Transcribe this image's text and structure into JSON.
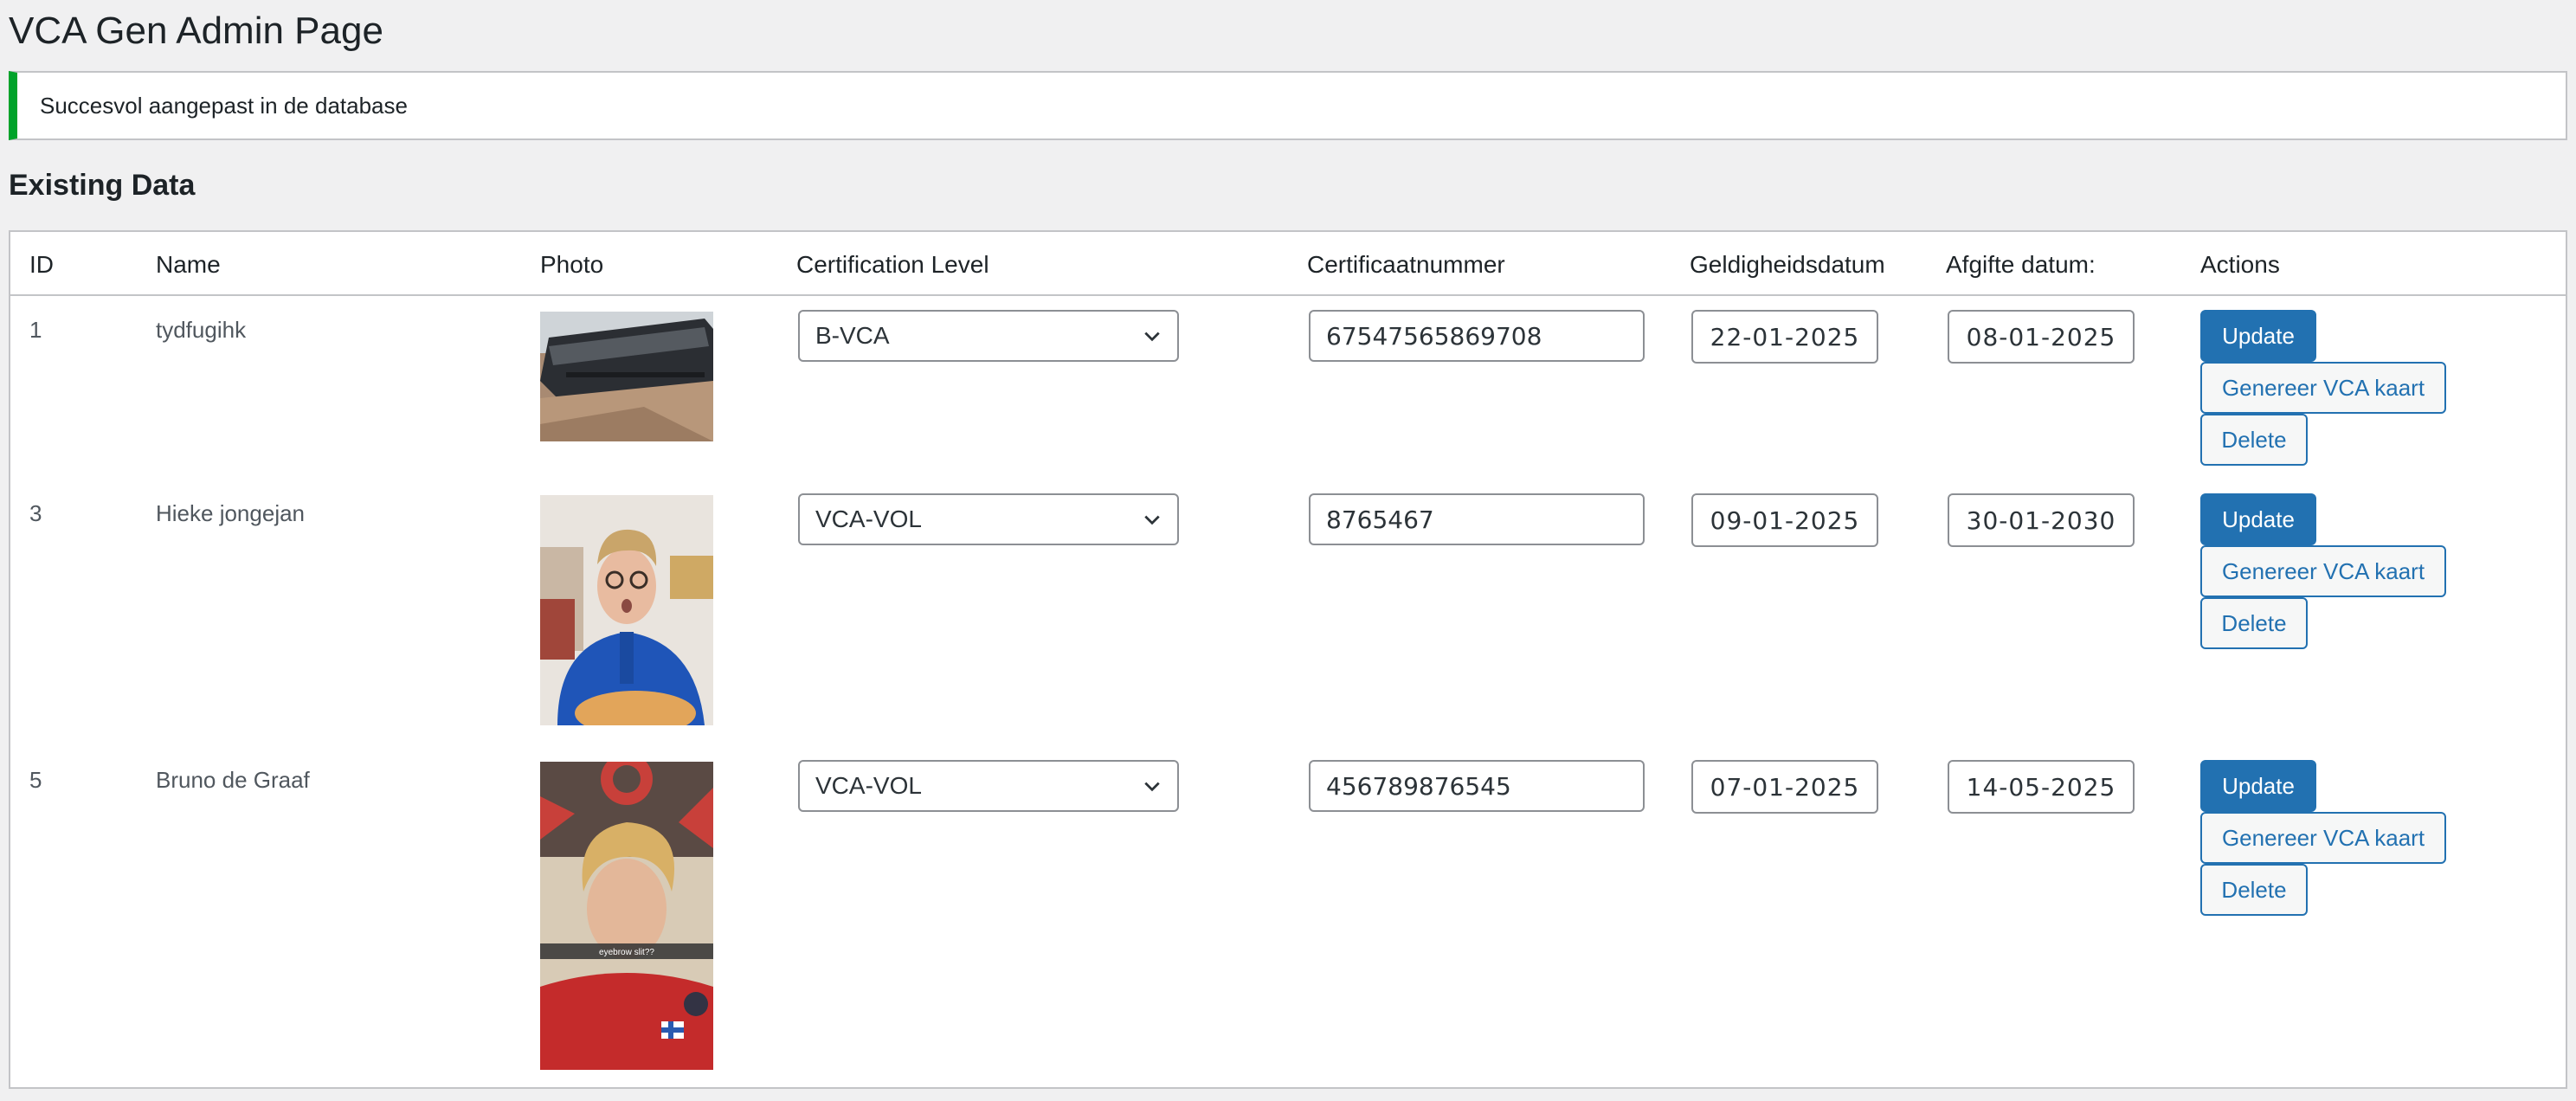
{
  "page": {
    "title": "VCA Gen Admin Page",
    "notice": "Succesvol aangepast in de database",
    "section_title": "Existing Data"
  },
  "table": {
    "headers": {
      "id": "ID",
      "name": "Name",
      "photo": "Photo",
      "level": "Certification Level",
      "number": "Certificaatnummer",
      "valid": "Geldigheidsdatum",
      "issued": "Afgifte datum:",
      "actions": "Actions"
    },
    "rows": [
      {
        "id": "1",
        "name": "tydfugihk",
        "level": "B-VCA",
        "number": "67547565869708",
        "valid": "22-01-2025",
        "issued": "08-01-2025"
      },
      {
        "id": "3",
        "name": "Hieke jongejan",
        "level": "VCA-VOL",
        "number": "8765467",
        "valid": "09-01-2025",
        "issued": "30-01-2030"
      },
      {
        "id": "5",
        "name": "Bruno de Graaf",
        "level": "VCA-VOL",
        "number": "456789876545",
        "valid": "07-01-2025",
        "issued": "14-05-2025"
      }
    ],
    "actions": {
      "update": "Update",
      "generate": "Genereer VCA kaart",
      "delete": "Delete"
    },
    "photo_caption": "eyebrow slit??"
  },
  "colors": {
    "primary": "#2271b1",
    "success": "#00a32a",
    "background": "#f0f0f1"
  },
  "icons": {
    "select_arrow": "chevron-down-icon"
  }
}
